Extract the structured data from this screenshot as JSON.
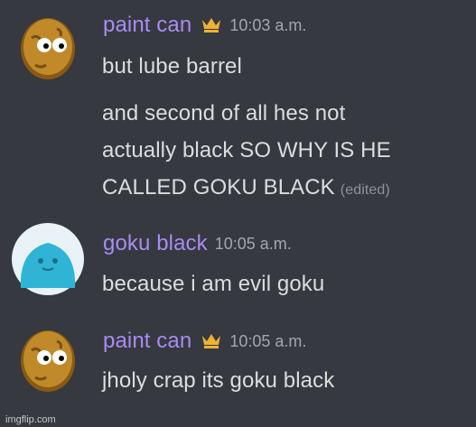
{
  "messages": [
    {
      "username": "paint can",
      "timestamp": "10:03 a.m.",
      "has_crown": true,
      "avatar": "wallnut-avatar",
      "lines": [
        "but lube barrel"
      ]
    },
    {
      "continuation": true,
      "lines": [
        "and second of all hes not",
        "actually black  SO WHY IS HE",
        "CALLED GOKU BLACK"
      ],
      "edited_label": "(edited)"
    },
    {
      "username": "goku black",
      "timestamp": "10:05 a.m.",
      "has_crown": false,
      "avatar": "blue-blob-avatar",
      "lines": [
        "because i am evil goku"
      ]
    },
    {
      "username": "paint can",
      "timestamp": "10:05 a.m.",
      "has_crown": true,
      "avatar": "wallnut-avatar",
      "lines": [
        "jholy crap its goku black"
      ]
    }
  ],
  "watermark": "imgflip.com",
  "colors": {
    "background": "#36393f",
    "username": "#a98bf5",
    "text": "#dcddde",
    "timestamp": "#a3a6aa",
    "crown": "#f0b232"
  }
}
